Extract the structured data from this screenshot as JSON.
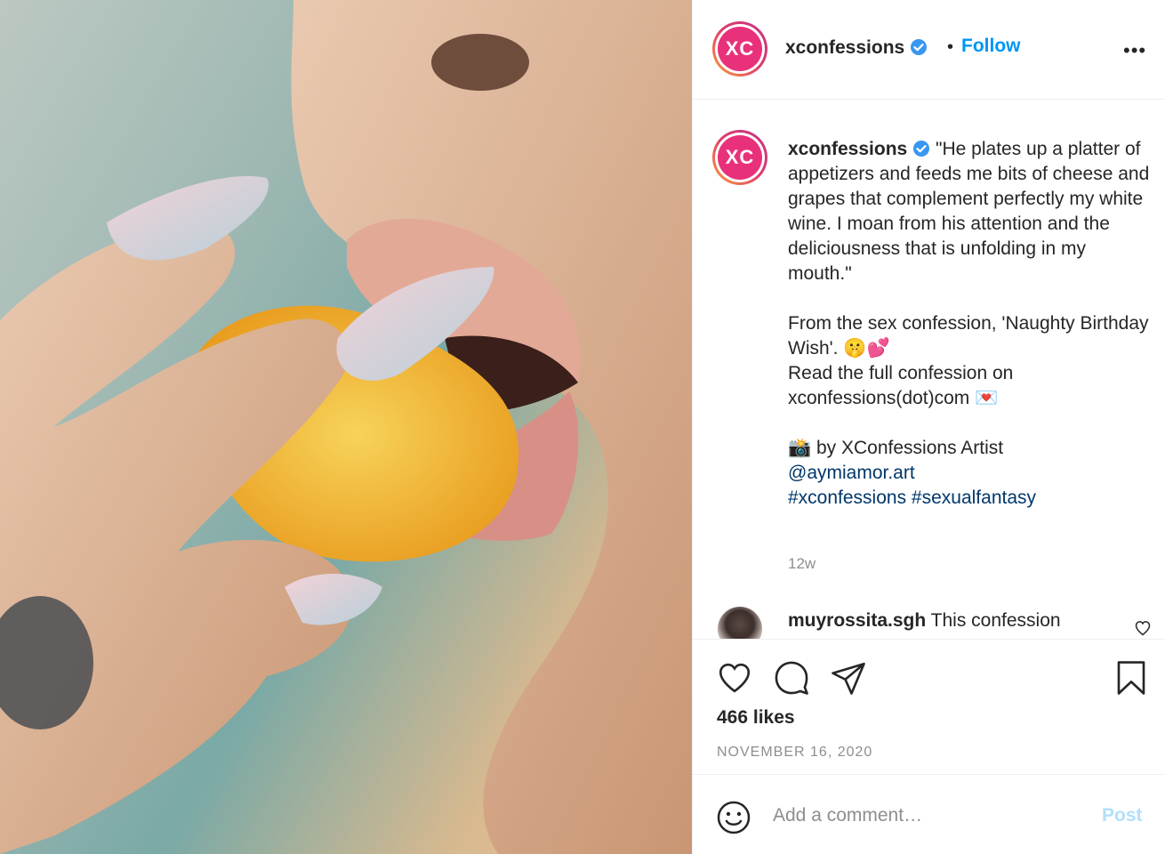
{
  "post": {
    "image_alt": "Woman biting an orange slice",
    "author": {
      "avatar_initials": "XC",
      "username": "xconfessions",
      "verified": true,
      "follow_label": "Follow",
      "more_label": "•••"
    },
    "caption": {
      "username": "xconfessions",
      "text_part1": " \"He plates up a platter of appetizers and feeds me bits of cheese and grapes that complement perfectly my white wine. I moan from his attention and the deliciousness that is unfolding in my mouth.\"\n\nFrom the sex confession, 'Naughty Birthday Wish'. 🤫💕\nRead the full confession on xconfessions(dot)com 💌\n\n📸 by XConfessions Artist ",
      "mention": "@aymiamor.art",
      "hashtag1": "#xconfessions",
      "hashtag2": "#sexualfantasy",
      "age": "12w"
    },
    "comments": [
      {
        "username": "muyrossita.sgh",
        "text": " This confession"
      }
    ],
    "likes": "466 likes",
    "date": "NOVEMBER 16, 2020",
    "add_comment": {
      "placeholder": "Add a comment…",
      "post_label": "Post"
    }
  },
  "colors": {
    "accent": "#0095f6",
    "link": "#00376b",
    "muted": "#8e8e8e",
    "avatar_bg": "#e8317a"
  },
  "icons": [
    "verified-badge-icon",
    "more-options-icon",
    "heart-icon",
    "comment-icon",
    "share-icon",
    "bookmark-icon",
    "emoji-icon"
  ]
}
